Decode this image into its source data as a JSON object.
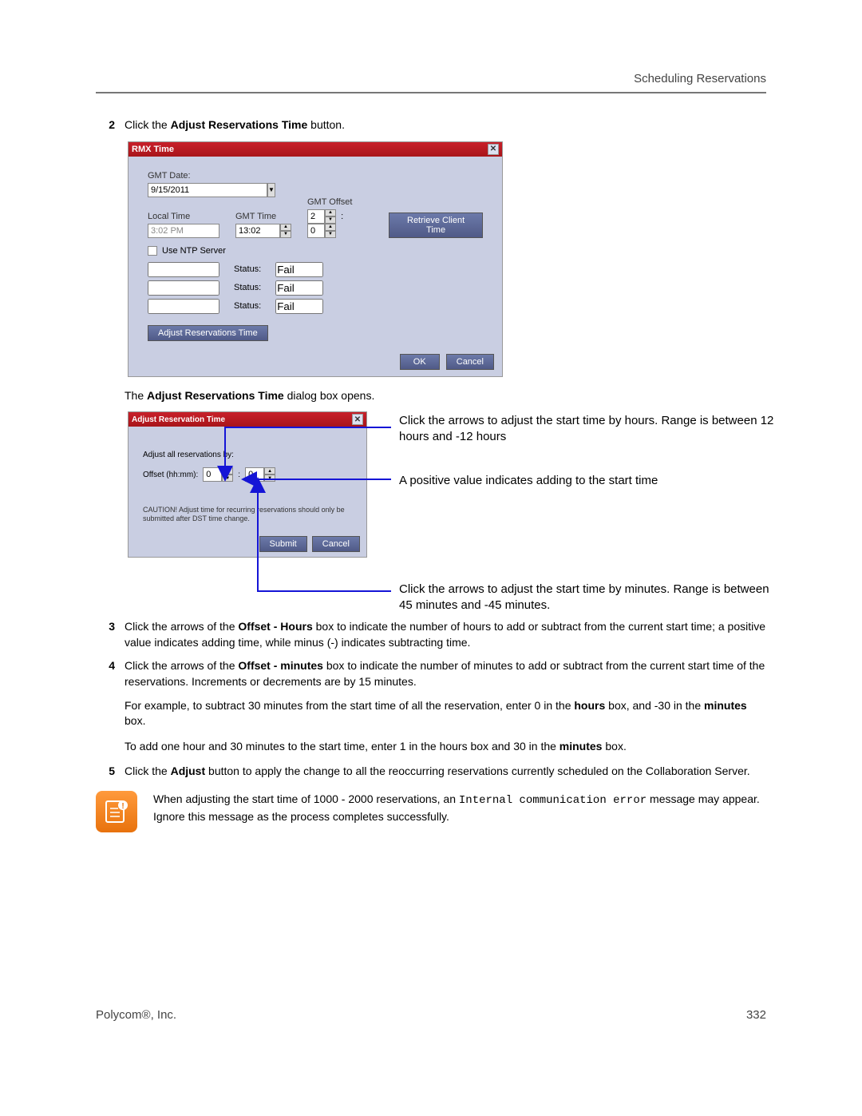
{
  "header": {
    "section": "Scheduling Reservations"
  },
  "step2": {
    "num": "2",
    "pre": "Click the ",
    "bold": "Adjust Reservations Time",
    "post": " button."
  },
  "dlg1": {
    "title": "RMX Time",
    "gmt_date_label": "GMT Date:",
    "gmt_date": "9/15/2011",
    "local_time_label": "Local Time",
    "local_time": "3:02 PM",
    "gmt_time_label": "GMT Time",
    "gmt_time": "13:02",
    "gmt_offset_label": "GMT Offset",
    "gmt_offset_h": "2",
    "gmt_offset_m": "0",
    "retrieve_btn": "Retrieve Client Time",
    "use_ntp_label": "Use NTP Server",
    "status_label": "Status:",
    "status_val": "Fail",
    "adjust_btn": "Adjust Reservations Time",
    "ok": "OK",
    "cancel": "Cancel",
    "colon": ":"
  },
  "intro2": {
    "pre": "The ",
    "bold": "Adjust Reservations Time",
    "post": " dialog box opens."
  },
  "dlg2": {
    "title": "Adjust Reservation Time",
    "heading": "Adjust all reservations by:",
    "offset_label": "Offset (hh:mm):",
    "h": "0",
    "m": "0",
    "caution": "CAUTION! Adjust time for recurring reservations should only be submitted after DST time change.",
    "submit": "Submit",
    "cancel": "Cancel",
    "colon": ":"
  },
  "annot": {
    "top": "Click the arrows to adjust the start time by hours. Range is between 12 hours and -12 hours",
    "mid": "A positive value indicates adding to the start time",
    "bot": "Click the arrows to adjust the start time by minutes. Range is between 45 minutes and -45 minutes."
  },
  "step3": {
    "num": "3",
    "t1": "Click the arrows of the ",
    "bold": "Offset - Hours",
    "t2": " box to indicate the number of hours to add or subtract from the current start time; a positive value indicates adding time, while minus (-) indicates subtracting time."
  },
  "step4": {
    "num": "4",
    "t1": "Click the arrows of the ",
    "bold": "Offset - minutes",
    "t2": " box to indicate the number of minutes to add or subtract from the current start time of the reservations. Increments or decrements are by 15 minutes."
  },
  "para_ex": {
    "t1": "For example, to subtract 30 minutes from the start time of all the reservation, enter 0 in the ",
    "b1": "hours",
    "t2": " box, and -30 in the ",
    "b2": "minutes",
    "t3": " box."
  },
  "para_add": {
    "t1": "To add one hour and 30 minutes to the start time, enter 1 in the hours box and 30 in the ",
    "b1": "minutes",
    "t2": " box."
  },
  "step5": {
    "num": "5",
    "t1": "Click the ",
    "bold": "Adjust",
    "t2": " button to apply the change to all the reoccurring reservations currently scheduled on the Collaboration Server."
  },
  "note": {
    "t1": "When adjusting the start time of 1000 - 2000 reservations, an ",
    "mono": "Internal communication error",
    "t2": " message may appear. Ignore this message as the process completes successfully."
  },
  "foot": {
    "company": "Polycom®, Inc.",
    "pagenum": "332"
  }
}
